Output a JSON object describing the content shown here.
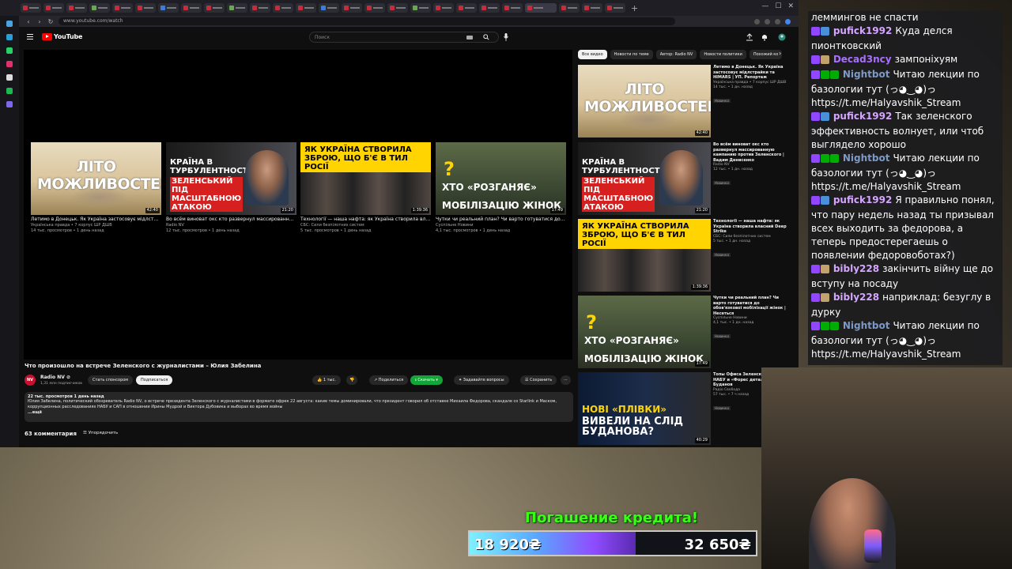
{
  "browser": {
    "url": "www.youtube.com/watch"
  },
  "youtube": {
    "logo_text": "YouTube",
    "search_placeholder": "Поиск"
  },
  "end_screen": [
    {
      "thumb_text": "ЛІТО МОЖЛИВОСТЕЙ",
      "duration": "42:40",
      "title": "Летимо в Донецьк. Як Україна застосовує мідлстрайки та HIMARS | УП. Репортаж",
      "channel": "Українська правда • 7 корпус ШР ДШВ",
      "meta": "14 тыс. просмотров • 1 день назад"
    },
    {
      "thumb_text_white": "КРАЇНА В ТУРБУЛЕНТНОСТІ",
      "thumb_text_red": "ЗЕЛЕНСЬКИЙ ПІД МАСШТАБНОЮ АТАКОЮ",
      "duration": "21:20",
      "title": "Во всём виноват окс кто развернул массированную кампанию против Зеленского | Вадим Денисенко",
      "channel": "Radio NV",
      "meta": "12 тыс. просмотров • 1 день назад"
    },
    {
      "thumb_text": "ЯК УКРАЇНА СТВОРИЛА ЗБРОЮ, ЩО Б'Є В ТИЛ РОСІЇ",
      "duration": "1:39:36",
      "title": "Технології — наша нафта: як Україна створила власний Deep Strike",
      "channel": "СБС: Сили безпілотних систем",
      "meta": "5 тыс. просмотров • 1 день назад"
    },
    {
      "thumb_line1": "ХТО «РОЗГАНЯЄ»",
      "thumb_line2": "МОБІЛІЗАЦІЮ ЖІНОК",
      "duration": "17:49",
      "title": "Чутки чи реальний план? Чи варто готуватися до обов'язкової мобілізації жінок | Несеться",
      "channel": "Суспільне Новини",
      "meta": "4,1 тыс. просмотров • 1 день назад"
    }
  ],
  "video": {
    "title": "Что произошло на встрече Зеленского с журналистами – Юлия Забелина",
    "channel_avatar": "NV",
    "channel_name": "Radio NV ⊘",
    "channel_subs": "1,31 млн подписчиков",
    "sponsor_label": "Стать спонсором",
    "subscribe_label": "Подписаться",
    "like_count": "1 тыс.",
    "share_label": "Поделиться",
    "download_label": "Скачать",
    "ask_label": "Задавайте вопросы",
    "save_label": "Сохранить",
    "more_label": "···",
    "desc_meta": "22 тыс. просмотров  1 день назад",
    "desc_text": "Юлия Забелина, политический обозреватель Radio NV, о встрече президента Зеленского с журналистами в формате офрек 22 августа: какие темы доминировали, что президент говорил об отставке Михаила Федорова, скандале со Starlink и Маском, коррупционных расследованиях НАБУ и САП в отношении Ирины Мудрой и Виктора Дубовика и выборах во время войны",
    "desc_more": "...ещё",
    "comments_count": "63 комментария",
    "sort_label": "Упорядочить"
  },
  "sidebar": {
    "chips": [
      "Все видео",
      "Новости по теме",
      "Автор: Radio NV",
      "Новости политики",
      "Похожий ко"
    ],
    "recs": [
      {
        "kind": "a",
        "thumb_text": "ЛІТО МОЖЛИВОСТЕЙ",
        "duration": "42:40",
        "title": "Летимо в Донецьк. Як Україна застосовує мідлстрайки та HIMARS | УП. Репортаж",
        "channel": "Українська правда • 7 корпус ШР ДШВ",
        "meta": "14 тыс. • 1 дн. назад",
        "badge": "Новинка"
      },
      {
        "kind": "b",
        "thumb_text_white": "КРАЇНА В ТУРБУЛЕНТНОСТІ",
        "thumb_text_red": "ЗЕЛЕНСЬКИЙ ПІД МАСШТАБНОЮ АТАКОЮ",
        "duration": "21:20",
        "title": "Во всём виноват окс кто развернул массированную кампанию против Зеленского | Вадим Денисенко",
        "channel": "Radio NV",
        "meta": "12 тыс. • 1 дн. назад",
        "badge": "Новинка"
      },
      {
        "kind": "c",
        "thumb_text": "ЯК УКРАЇНА СТВОРИЛА ЗБРОЮ, ЩО Б'Є В ТИЛ РОСІЇ",
        "duration": "1:39:36",
        "title": "Технології — наша нафта: як Україна створила власний Deep Strike",
        "channel": "СБС: Сили безпілотних систем",
        "meta": "5 тыс. • 1 дн. назад",
        "badge": "Новинка"
      },
      {
        "kind": "d",
        "thumb_line1": "ХТО «РОЗГАНЯЄ»",
        "thumb_line2": "МОБІЛІЗАЦІЮ ЖІНОК",
        "duration": "17:49",
        "title": "Чутки чи реальний план? Чи варто готуватися до обов'язкової мобілізації жінок | Несеться",
        "channel": "Суспільне Новини",
        "meta": "4,1 тыс. • 1 дн. назад",
        "badge": "Новинка"
      },
      {
        "kind": "e",
        "thumb_text_yellow": "НОВІ «ПЛІВКИ»",
        "thumb_text_white": "ВИВЕЛИ НА СЛІД БУДАНОВА?",
        "duration": "40:29",
        "title": "Топы Офиса Зеленского планах НАБУ и «Форес детали и роль Буданов",
        "channel": "Радіо Свобода",
        "meta": "57 тыс. • 7 ч назад",
        "badge": "Новинка"
      }
    ]
  },
  "chat": [
    {
      "user": "",
      "color": "#ffffff",
      "text": "леммингов не спасти",
      "badges": []
    },
    {
      "user": "pufick1992",
      "color": "#d4a6ff",
      "text": "Куда делся пионтковский",
      "badges": [
        "#9147ff",
        "#4a90d9"
      ]
    },
    {
      "user": "Decad3ncy",
      "color": "#a970ff",
      "text": "зампоніхуям",
      "badges": [
        "#9147ff",
        "#c2a36b"
      ]
    },
    {
      "user": "Nightbot",
      "color": "#7d9ac7",
      "text": "Читаю лекции по базологии тут (っ◕‿◕)っ https://t.me/Halyavshik_Stream",
      "badges": [
        "#9147ff",
        "#00ad03",
        "#00ad03"
      ]
    },
    {
      "user": "pufick1992",
      "color": "#d4a6ff",
      "text": "Так зеленского эффективность волнует, или чтоб выглядело хорошо",
      "badges": [
        "#9147ff",
        "#4a90d9"
      ]
    },
    {
      "user": "Nightbot",
      "color": "#7d9ac7",
      "text": "Читаю лекции по базологии тут (っ◕‿◕)っ https://t.me/Halyavshik_Stream",
      "badges": [
        "#9147ff",
        "#00ad03",
        "#00ad03"
      ]
    },
    {
      "user": "pufick1992",
      "color": "#d4a6ff",
      "text": "Я правильно понял, что пару недель назад ты призывал всех выходить за федорова, а теперь предостерегаешь о появлении федоровоботах?)",
      "badges": [
        "#9147ff",
        "#4a90d9"
      ]
    },
    {
      "user": "bibly228",
      "color": "#d4a6ff",
      "text": "закінчить війну ще до вступу на посаду",
      "badges": [
        "#9147ff",
        "#c2a36b"
      ]
    },
    {
      "user": "bibly228",
      "color": "#d4a6ff",
      "text": "наприклад: безуглу в дурку",
      "badges": [
        "#9147ff",
        "#c2a36b"
      ]
    },
    {
      "user": "Nightbot",
      "color": "#7d9ac7",
      "text": "Читаю лекции по базологии тут (っ◕‿◕)っ https://t.me/Halyavshik_Stream",
      "badges": [
        "#9147ff",
        "#00ad03",
        "#00ad03"
      ]
    }
  ],
  "donation": {
    "title": "Погашение кредита!",
    "current": "18 920₴",
    "goal": "32 650₴",
    "progress": 0.58
  }
}
